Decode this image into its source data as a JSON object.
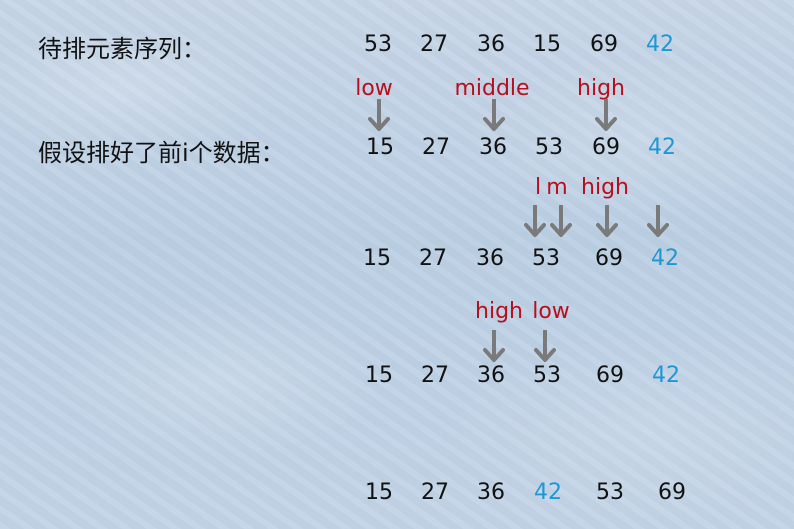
{
  "colors": {
    "number": "#111111",
    "highlight_number": "#1f97d4",
    "pointer_label": "#b80f1e",
    "arrow": "#7a7a7a"
  },
  "labels": {
    "sequence": "待排元素序列：",
    "assume": "假设排好了前i个数据："
  },
  "rows": {
    "r1": [
      "53",
      "27",
      "36",
      "15",
      "69",
      "42"
    ],
    "r2": [
      "15",
      "27",
      "36",
      "53",
      "69",
      "42"
    ],
    "r3": [
      "15",
      "27",
      "36",
      "53",
      "69",
      "42"
    ],
    "r4": [
      "15",
      "27",
      "36",
      "53",
      "69",
      "42"
    ],
    "r5": [
      "15",
      "27",
      "36",
      "42",
      "53",
      "69"
    ]
  },
  "pointers": {
    "p1": [
      "low",
      "middle",
      "high"
    ],
    "p2": [
      "l",
      "m",
      "high"
    ],
    "p3": [
      "high",
      "low"
    ]
  },
  "icons": {
    "arrow": "arrow-down-icon"
  }
}
